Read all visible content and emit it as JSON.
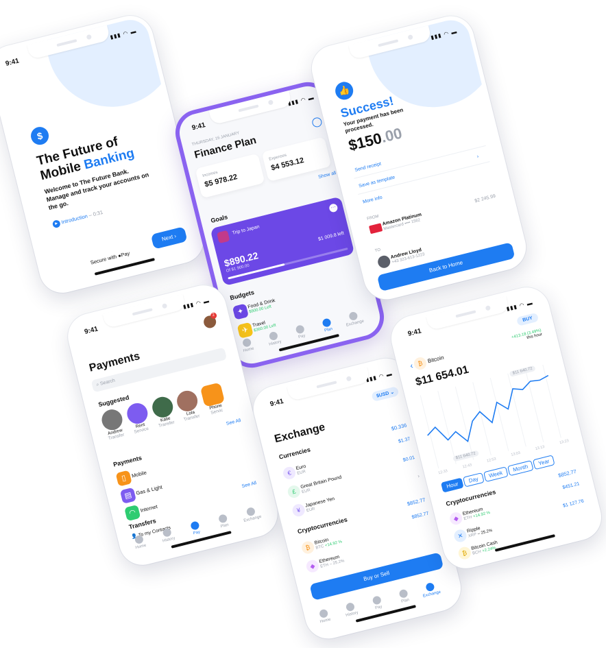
{
  "status_time": "9:41",
  "welcome": {
    "title_line1": "The Future of",
    "title_line2": "Mobile",
    "title_accent": "Banking",
    "subtitle": "Welcome to The Future Bank. Manage and track your accounts on the go.",
    "intro_link": "Introduction",
    "intro_duration": "– 0:31",
    "secure_label": "Secure with",
    "pay_label": "Pay",
    "next_button": "Next"
  },
  "finance": {
    "date": "THURSDAY, 16 JANUARY",
    "title": "Finance Plan",
    "incomes_label": "Incomes",
    "incomes_value": "$5 978.22",
    "expenses_label": "Expenses",
    "expenses_value": "$4 553.12",
    "show_all": "Show all",
    "goals_heading": "Goals",
    "goal_name": "Trip to Japan",
    "goal_amount": "$890.22",
    "goal_of": "Of $1 900.00",
    "goal_left": "$1 009.8 left",
    "goal_progress": 0.47,
    "budgets_heading": "Budgets",
    "budgets": [
      {
        "name": "Food & Drink",
        "left": "$900.00 Left"
      },
      {
        "name": "Travel",
        "left": "$360.00 Left"
      }
    ],
    "tabs": [
      "Home",
      "History",
      "Pay",
      "Plan",
      "Exchange"
    ],
    "active_tab": "Plan"
  },
  "success": {
    "title": "Success!",
    "message": "Your payment has been processed.",
    "amount_main": "$150",
    "amount_cents": ".00",
    "links": [
      "Send receipt",
      "Save as template",
      "More info"
    ],
    "from_label": "FROM",
    "from_name": "Amazon Platinum",
    "from_card": "Mastercard •••• 1562",
    "from_balance": "$2 245.99",
    "to_label": "TO",
    "to_name": "Andrew Lloyd",
    "to_phone": "+43 323-613-1223",
    "button": "Back to Home"
  },
  "payments": {
    "title": "Payments",
    "search_placeholder": "Search",
    "badge": "2",
    "suggested_heading": "Suggested",
    "suggested": [
      {
        "name": "Andrew",
        "sub": "Transfer"
      },
      {
        "name": "Rent",
        "sub": "Service"
      },
      {
        "name": "Katie",
        "sub": "Transfer"
      },
      {
        "name": "Lola",
        "sub": "Transfer"
      },
      {
        "name": "Phone",
        "sub": "Servic"
      }
    ],
    "see_all": "See All",
    "payments_heading": "Payments",
    "items": [
      "Mobile",
      "Gas & Light",
      "Internet"
    ],
    "transfers_heading": "Transfers",
    "transfer_item": "To my Contacts",
    "tabs": [
      "Home",
      "History",
      "Pay",
      "Plan",
      "Exchange"
    ],
    "active_tab": "Pay"
  },
  "exchange": {
    "currency_selector": "$USD",
    "title": "Exchange",
    "currencies_heading": "Currencies",
    "currencies_value": "$0.336",
    "currencies": [
      {
        "symbol": "€",
        "name": "Euro",
        "code": "EUR",
        "value": "$1.37",
        "color": "#7d5cf0"
      },
      {
        "symbol": "£",
        "name": "Great Britain Pound",
        "code": "EUR",
        "value": "$0.01",
        "color": "#2ecc71"
      },
      {
        "symbol": "¥",
        "name": "Japanese Yen",
        "code": "EUR",
        "value": "",
        "color": "#7d5cf0"
      }
    ],
    "crypto_heading": "Cryptocurrencies",
    "crypto_value": "$852.77",
    "crypto": [
      {
        "symbol": "₿",
        "name": "Bitcoin",
        "code": "BTC",
        "change": "+14.92 %",
        "value": "$852.77",
        "color": "#f7931a"
      },
      {
        "symbol": "◆",
        "name": "Ethereum",
        "code": "ETH",
        "change": "– 25.2%",
        "value": "",
        "color": "#b35cf0"
      }
    ],
    "button": "Buy or Sell",
    "tabs": [
      "Home",
      "History",
      "Pay",
      "Plan",
      "Exchange"
    ],
    "active_tab": "Exchange"
  },
  "bitcoin": {
    "buy_button": "BUY",
    "coin_name": "Bitcoin",
    "price": "$11 654.01",
    "change": "+413.18 (3.49%)",
    "change_period": "this hour",
    "high_label": "$11 640.72",
    "low_label": "$11 640.72",
    "x_ticks": [
      "12:33",
      "12:43",
      "12:53",
      "13:03",
      "13:13",
      "13:23"
    ],
    "ranges": [
      "Hour",
      "Day",
      "Week",
      "Month",
      "Year"
    ],
    "active_range": "Hour",
    "crypto_heading": "Cryptocurrencies",
    "crypto_value": "$852.77",
    "crypto": [
      {
        "symbol": "◆",
        "name": "Ethereum",
        "code": "ETH",
        "change": "+14.92 %",
        "value": "$451.21",
        "color": "#b35cf0"
      },
      {
        "symbol": "✕",
        "name": "Ripple",
        "code": "XRP",
        "change": "– 25.2%",
        "value": "$1 127.76",
        "color": "#1e7cf2"
      },
      {
        "symbol": "₿",
        "name": "Bitcoin Cash",
        "code": "BCH",
        "change": "+2.24%",
        "value": "",
        "color": "#f7c31a"
      }
    ],
    "chart_points": [
      0.45,
      0.55,
      0.3,
      0.4,
      0.2,
      0.5,
      0.62,
      0.4,
      0.7,
      0.55,
      0.85,
      0.8,
      0.9,
      0.88,
      0.92
    ]
  },
  "colors": {
    "accent": "#1e7cf2",
    "purple": "#8a63f0",
    "positive": "#2ecc71"
  }
}
